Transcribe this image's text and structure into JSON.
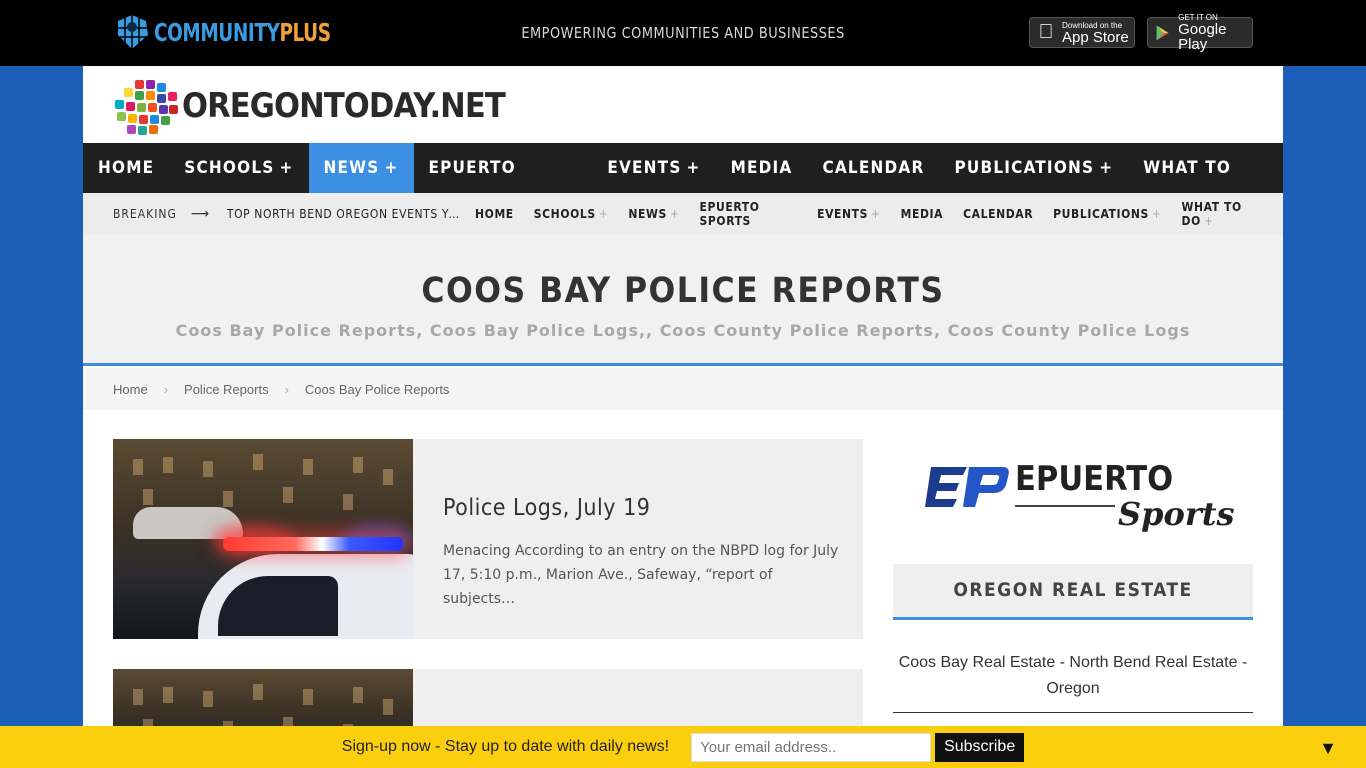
{
  "topbar": {
    "brand_part1": "COMMUNITY",
    "brand_part2": "PLUS",
    "tagline": "EMPOWERING COMMUNITIES AND BUSINESSES",
    "appstore": {
      "small": "Download on the",
      "big": "App Store"
    },
    "googleplay": {
      "small": "GET IT ON",
      "big": "Google Play"
    }
  },
  "site": {
    "name": "OREGONTODAY.NET"
  },
  "mainnav": [
    {
      "label": "HOME",
      "plus": ""
    },
    {
      "label": "SCHOOLS",
      "plus": "+"
    },
    {
      "label": "NEWS",
      "plus": "+"
    },
    {
      "label": "EPUERTO SPORTS",
      "plus": ""
    },
    {
      "label": "EVENTS",
      "plus": "+"
    },
    {
      "label": "MEDIA",
      "plus": ""
    },
    {
      "label": "CALENDAR",
      "plus": ""
    },
    {
      "label": "PUBLICATIONS",
      "plus": "+"
    },
    {
      "label": "WHAT TO DO",
      "plus": "+"
    }
  ],
  "subbar": {
    "breaking": "BREAKING",
    "arrow": "⟶",
    "ticker": "TOP NORTH BEND OREGON EVENTS YOU CAN'T MISS",
    "items": [
      {
        "label": "HOME",
        "plus": ""
      },
      {
        "label": "SCHOOLS",
        "plus": "+"
      },
      {
        "label": "NEWS",
        "plus": "+"
      },
      {
        "label": "EPUERTO SPORTS",
        "plus": ""
      },
      {
        "label": "EVENTS",
        "plus": "+"
      },
      {
        "label": "MEDIA",
        "plus": ""
      },
      {
        "label": "CALENDAR",
        "plus": ""
      },
      {
        "label": "PUBLICATIONS",
        "plus": "+"
      },
      {
        "label": "WHAT TO DO",
        "plus": "+"
      }
    ]
  },
  "hero": {
    "title": "COOS BAY POLICE REPORTS",
    "subtitle": "Coos Bay Police Reports, Coos Bay Police Logs,, Coos County Police Reports, Coos County Police Logs"
  },
  "breadcrumb": {
    "home": "Home",
    "section": "Police Reports",
    "current": "Coos Bay Police Reports",
    "sep": "›"
  },
  "articles": [
    {
      "title": "Police Logs, July 19",
      "excerpt": "Menacing According to an entry on the NBPD log for July 17, 5:10 p.m., Marion Ave., Safeway, “report of subjects…"
    }
  ],
  "sidebar": {
    "logo_word1": "EPUERTO",
    "logo_word2": "Sports",
    "widget_title": "OREGON REAL ESTATE",
    "widget_text": "Coos Bay Real Estate - North Bend Real Estate - Oregon"
  },
  "subscribe": {
    "message": "Sign-up now - Stay up to date with daily news!",
    "placeholder": "Your email address..",
    "button": "Subscribe",
    "collapse": "▼"
  },
  "colors": {
    "accent": "#3d8fe3",
    "page_bg": "#1d5fb8",
    "subscribe_bg": "#fccf0e"
  }
}
